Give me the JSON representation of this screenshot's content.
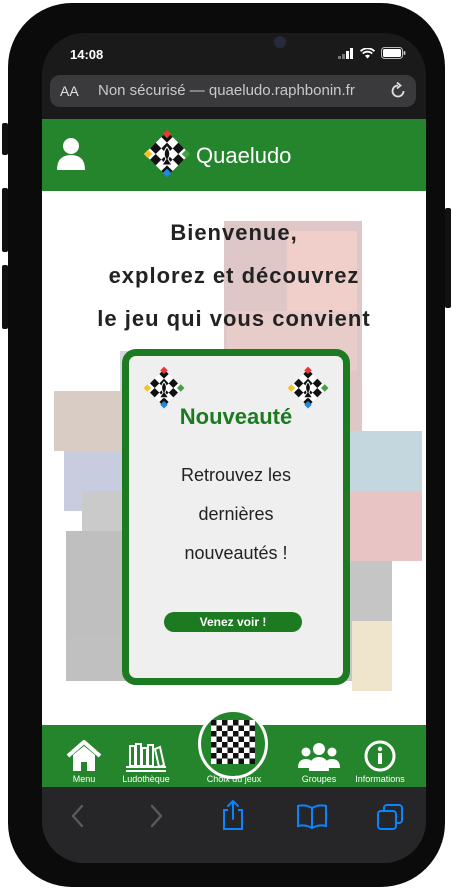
{
  "status_bar": {
    "time": "14:08"
  },
  "browser": {
    "aa_label": "AA",
    "url_text": "Non sécurisé — quaeludo.raphbonin.fr"
  },
  "header": {
    "brand": "Quaeludo"
  },
  "welcome": {
    "line1": "Bienvenue,",
    "line2": "explorez et découvrez",
    "line3": "le jeu qui vous convient"
  },
  "card": {
    "title": "Nouveauté",
    "desc_line1": "Retrouvez les",
    "desc_line2": "dernières",
    "desc_line3": "nouveautés !",
    "cta_label": "Venez voir !"
  },
  "bottom_nav": {
    "items": [
      {
        "label": "Menu",
        "icon": "home-icon"
      },
      {
        "label": "Ludothèque",
        "icon": "library-icon"
      },
      {
        "label": "Choix du jeux",
        "icon": "chessboard-icon"
      },
      {
        "label": "Groupes",
        "icon": "group-icon"
      },
      {
        "label": "Informations",
        "icon": "info-icon"
      }
    ]
  },
  "colors": {
    "brand_green": "#25852c",
    "card_border": "#1c7a20",
    "safari_accent": "#0a84ff"
  }
}
